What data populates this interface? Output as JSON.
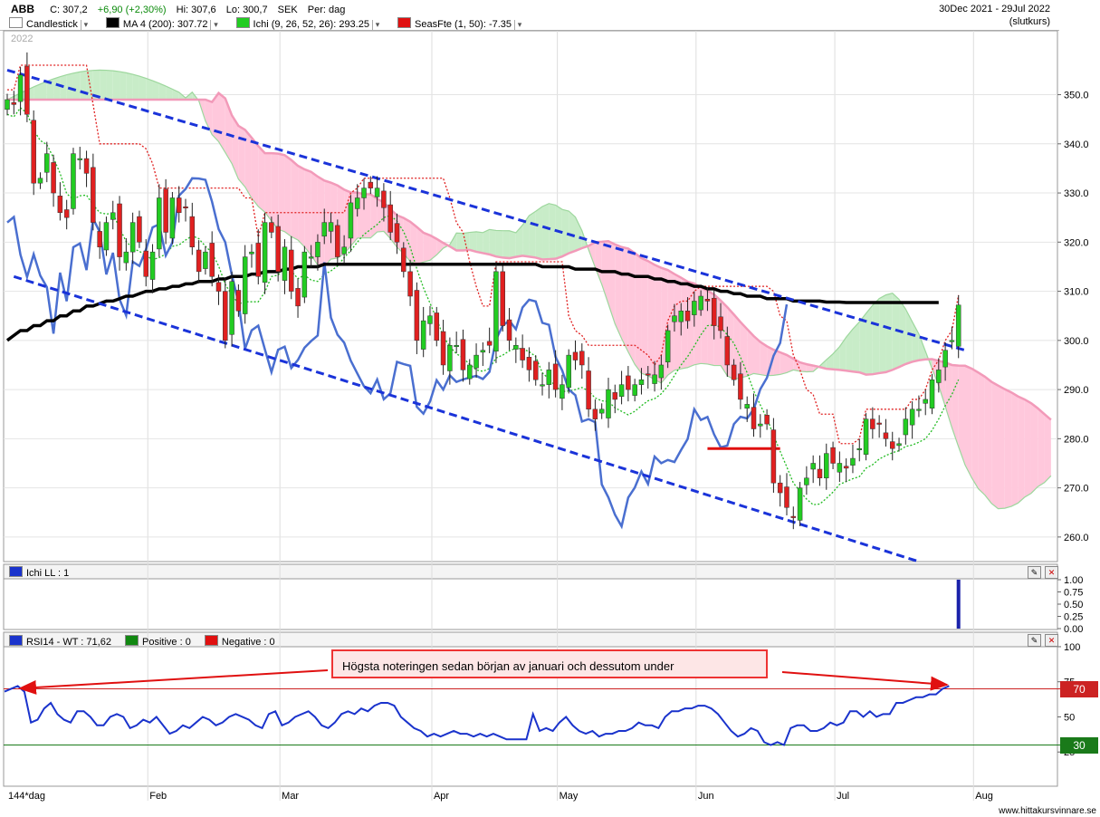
{
  "header": {
    "symbol": "ABB",
    "close": "C: 307,2",
    "change": "+6,90 (+2,30%)",
    "high": "Hi: 307,6",
    "low": "Lo: 300,7",
    "currency": "SEK",
    "period": "Per: dag",
    "date_range": "30Dec 2021 - 29Jul 2022",
    "price_mode": "(slutkurs)",
    "legend": [
      {
        "label": "Candlestick",
        "color": "#ffffff"
      },
      {
        "label": "MA 4 (200): 307.72",
        "color": "#000000"
      },
      {
        "label": "Ichi (9, 26, 52, 26): 293.25",
        "color": "#22cc22"
      },
      {
        "label": "SeasFte (1, 50): -7.35",
        "color": "#e01010"
      }
    ]
  },
  "panes": {
    "ichi_ll_title": "Ichi LL : 1",
    "rsi_title": "RSI14 - WT : 71,62",
    "positive": "Positive : 0",
    "negative": "Negative : 0"
  },
  "annotation": {
    "text": "Högsta noteringen sedan början av januari och dessutom under"
  },
  "footer": {
    "site": "www.hittakursvinnare.se"
  },
  "colors": {
    "up": "#22cc22",
    "down": "#e02020",
    "ma": "#000000",
    "trend": "#1a33d9",
    "rsi": "#1a33cc",
    "cloud_up": "#c8ecc8",
    "cloud_down": "#ffc8dc"
  },
  "chart_data": [
    {
      "type": "candlestick",
      "year_label": "2022",
      "x_labels": [
        "144*dag",
        "Feb",
        "Mar",
        "Apr",
        "May",
        "Jun",
        "Jul",
        "Aug"
      ],
      "y_ticks": [
        260,
        270,
        280,
        290,
        300,
        310,
        320,
        330,
        340,
        350
      ],
      "ylim": [
        255,
        363
      ],
      "closes": [
        349,
        348,
        354,
        346,
        332,
        333,
        338,
        330,
        326,
        325,
        338,
        337,
        334,
        324,
        319,
        324,
        326,
        317,
        318,
        324,
        320,
        313,
        318,
        329,
        322,
        329,
        326,
        327,
        319,
        314,
        318,
        313,
        310,
        300,
        312,
        306,
        317,
        318,
        313,
        324,
        322,
        314,
        319,
        310,
        307,
        318,
        317,
        320,
        324,
        324,
        317,
        319,
        328,
        329,
        331,
        331,
        331,
        327,
        322,
        320,
        314,
        309,
        300,
        304,
        305,
        300,
        295,
        299,
        299,
        294,
        295,
        297,
        298,
        299,
        314,
        303,
        300,
        299,
        296,
        294,
        292,
        291,
        294,
        290,
        291,
        297,
        296,
        295,
        286,
        284,
        286,
        290,
        288,
        291,
        290,
        291,
        292,
        293,
        293,
        295,
        302,
        305,
        306,
        304,
        308,
        309,
        308,
        303,
        302,
        295,
        292,
        288,
        287,
        282,
        283,
        283,
        271,
        269,
        266,
        264,
        270,
        272,
        275,
        272,
        277,
        275,
        275,
        274,
        276,
        278,
        284,
        282,
        283,
        280,
        278,
        279,
        284,
        286,
        286,
        288,
        292,
        294,
        298,
        300,
        307.2
      ],
      "ma200": [
        300,
        301,
        302,
        302,
        303,
        303,
        304,
        304,
        305,
        305,
        306,
        306,
        307,
        307,
        307.5,
        308,
        308,
        308.5,
        309,
        309,
        309.5,
        310,
        310,
        310.5,
        310.5,
        311,
        311,
        311.5,
        311.5,
        312,
        312,
        312,
        312.5,
        312.5,
        313,
        313,
        313,
        313.5,
        313.5,
        314,
        314,
        314,
        314.5,
        314.5,
        315,
        315,
        315,
        315,
        315.5,
        315.5,
        315.5,
        315.5,
        315.5,
        315.5,
        315.5,
        315.5,
        315.5,
        315.5,
        315.5,
        315.5,
        315.5,
        315.5,
        315.5,
        315.5,
        315.5,
        315.5,
        315.5,
        315.5,
        315.5,
        315.5,
        315.5,
        315.5,
        315.5,
        315.5,
        315.5,
        315.5,
        315.5,
        315.5,
        315.5,
        315.5,
        315.5,
        315,
        315,
        315,
        315,
        315,
        314.5,
        314.5,
        314.5,
        314.5,
        314,
        314,
        314,
        313.5,
        313.5,
        313,
        313,
        313,
        312.5,
        312.5,
        312,
        312,
        311.5,
        311.5,
        311,
        311,
        310.5,
        310.5,
        310,
        310,
        309.5,
        309.5,
        309,
        309,
        309,
        308.5,
        308.5,
        308.5,
        308.5,
        308,
        308,
        308,
        308,
        308,
        307.8,
        307.8,
        307.8,
        307.7,
        307.7,
        307.7,
        307.7,
        307.7,
        307.7,
        307.7,
        307.7,
        307.7,
        307.7,
        307.7,
        307.7,
        307.7,
        307.7,
        307.72
      ],
      "upper_trendline": [
        [
          0,
          355
        ],
        [
          145,
          298
        ]
      ],
      "lower_trendline": [
        [
          1,
          313
        ],
        [
          138,
          255
        ]
      ],
      "annotation_line": {
        "from_index": 106,
        "to_index": 117,
        "value": 278
      }
    },
    {
      "type": "bar",
      "name": "Ichi LL",
      "y_ticks": [
        0,
        0.25,
        0.5,
        0.75,
        1.0
      ],
      "ylim": [
        0,
        1
      ],
      "last_value": 1
    },
    {
      "type": "line",
      "name": "RSI14",
      "y_ticks": [
        25,
        50,
        75,
        100
      ],
      "ylim": [
        0,
        100
      ],
      "levels": [
        70,
        30
      ],
      "values": [
        68,
        70,
        72,
        68,
        46,
        48,
        56,
        60,
        52,
        48,
        46,
        54,
        54,
        50,
        44,
        44,
        50,
        52,
        50,
        42,
        44,
        48,
        46,
        50,
        44,
        38,
        40,
        44,
        42,
        46,
        50,
        48,
        44,
        46,
        50,
        52,
        50,
        48,
        44,
        42,
        52,
        54,
        44,
        46,
        50,
        52,
        54,
        50,
        44,
        42,
        46,
        52,
        54,
        52,
        56,
        54,
        58,
        60,
        60,
        58,
        50,
        46,
        42,
        40,
        36,
        38,
        36,
        38,
        40,
        38,
        38,
        36,
        38,
        36,
        38,
        36,
        34,
        34,
        34,
        34,
        52,
        40,
        42,
        40,
        46,
        50,
        44,
        40,
        38,
        40,
        36,
        38,
        38,
        40,
        40,
        42,
        46,
        44,
        44,
        42,
        50,
        54,
        54,
        56,
        56,
        58,
        58,
        56,
        52,
        46,
        40,
        36,
        38,
        42,
        40,
        32,
        30,
        32,
        30,
        42,
        44,
        44,
        40,
        40,
        42,
        46,
        44,
        46,
        54,
        54,
        50,
        54,
        50,
        52,
        52,
        60,
        60,
        62,
        64,
        64,
        66,
        66,
        70,
        72
      ]
    }
  ]
}
